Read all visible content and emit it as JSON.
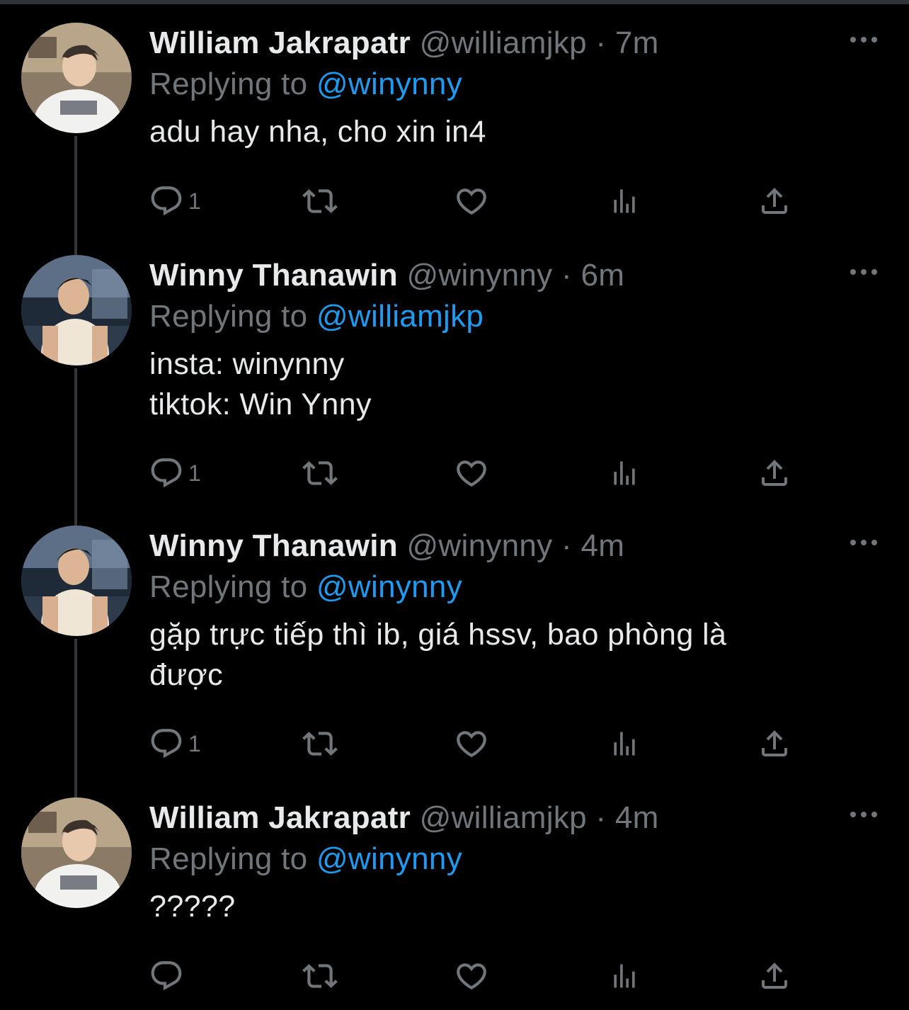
{
  "tweets": [
    {
      "display_name": "William Jakrapatr",
      "handle": "@williamjkp",
      "separator": "·",
      "time": "7m",
      "replying_prefix": "Replying to",
      "replying_to": "@winynny",
      "lines": [
        "adu hay nha, cho xin in4"
      ],
      "reply_count": "1",
      "avatar": "avatar-william"
    },
    {
      "display_name": "Winny Thanawin",
      "handle": "@winynny",
      "separator": "·",
      "time": "6m",
      "replying_prefix": "Replying to",
      "replying_to": "@williamjkp",
      "lines": [
        "insta: winynny",
        "tiktok: Win Ynny"
      ],
      "reply_count": "1",
      "avatar": "avatar-winny"
    },
    {
      "display_name": "Winny Thanawin",
      "handle": "@winynny",
      "separator": "·",
      "time": "4m",
      "replying_prefix": "Replying to",
      "replying_to": "@winynny",
      "lines": [
        "gặp trực tiếp thì ib, giá hssv, bao phòng là",
        "được"
      ],
      "reply_count": "1",
      "avatar": "avatar-winny"
    },
    {
      "display_name": "William Jakrapatr",
      "handle": "@williamjkp",
      "separator": "·",
      "time": "4m",
      "replying_prefix": "Replying to",
      "replying_to": "@winynny",
      "lines": [
        "?????"
      ],
      "reply_count": "",
      "avatar": "avatar-william"
    }
  ],
  "icons": {
    "reply": "reply-icon",
    "retweet": "retweet-icon",
    "like": "heart-icon",
    "views": "views-icon",
    "share": "share-icon",
    "more": "more-icon"
  },
  "colors": {
    "background": "#000000",
    "primary_text": "#e7e9ea",
    "secondary_text": "#71767b",
    "mention": "#1d9bf0",
    "thread_line": "#333639"
  }
}
